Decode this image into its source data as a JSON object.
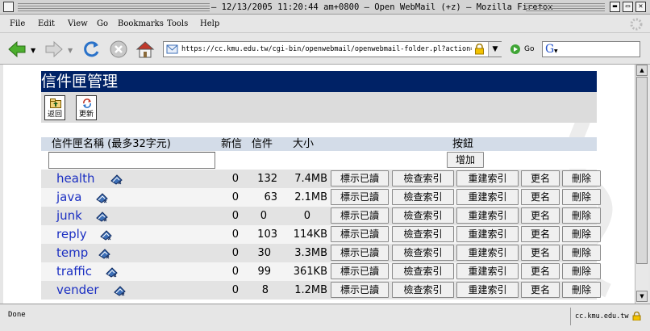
{
  "window": {
    "title": "– 12/13/2005 11:20:44 am+0800 – Open WebMail (+z) – Mozilla Firefox",
    "icons": [
      "window-menu-icon",
      "minimize-icon",
      "maximize-icon",
      "close-icon"
    ]
  },
  "menu": [
    "File",
    "Edit",
    "View",
    "Go",
    "Bookmarks",
    "Tools",
    "Help"
  ],
  "nav": {
    "url": "https://cc.kmu.edu.tw/cgi-bin/openwebmail/openwebmail-folder.pl?action=e",
    "go_label": "Go",
    "search_value": "",
    "icons": [
      "back-icon",
      "forward-icon",
      "reload-icon",
      "stop-icon",
      "home-icon",
      "lock-icon",
      "go-icon",
      "google-icon"
    ]
  },
  "page": {
    "title": "信件匣管理",
    "toolbar": {
      "back_label": "返回",
      "refresh_label": "更新"
    }
  },
  "table": {
    "headers": {
      "name": "信件匣名稱 (最多32字元)",
      "new": "新信",
      "count": "信件",
      "size": "大小",
      "buttons": "按鈕"
    },
    "new_folder_value": "",
    "add_label": "增加",
    "action_labels": {
      "mark_read": "標示已讀",
      "check_index": "檢查索引",
      "rebuild_index": "重建索引",
      "rename": "更名",
      "delete": "刪除"
    },
    "rows": [
      {
        "name": "health",
        "new": "0",
        "count": "132",
        "size": "7.4MB"
      },
      {
        "name": "java",
        "new": "0",
        "count": "63",
        "size": "2.1MB"
      },
      {
        "name": "junk",
        "new": "0",
        "count": "0",
        "size": "0"
      },
      {
        "name": "reply",
        "new": "0",
        "count": "103",
        "size": "114KB"
      },
      {
        "name": "temp",
        "new": "0",
        "count": "30",
        "size": "3.3MB"
      },
      {
        "name": "traffic",
        "new": "0",
        "count": "99",
        "size": "361KB"
      },
      {
        "name": "vender",
        "new": "0",
        "count": "8",
        "size": "1.2MB"
      }
    ]
  },
  "status": {
    "text": "Done",
    "host": "cc.kmu.edu.tw"
  },
  "colors": {
    "title_bg": "#002266",
    "link": "#1b2fc2",
    "header_bg": "#d3dce8"
  }
}
